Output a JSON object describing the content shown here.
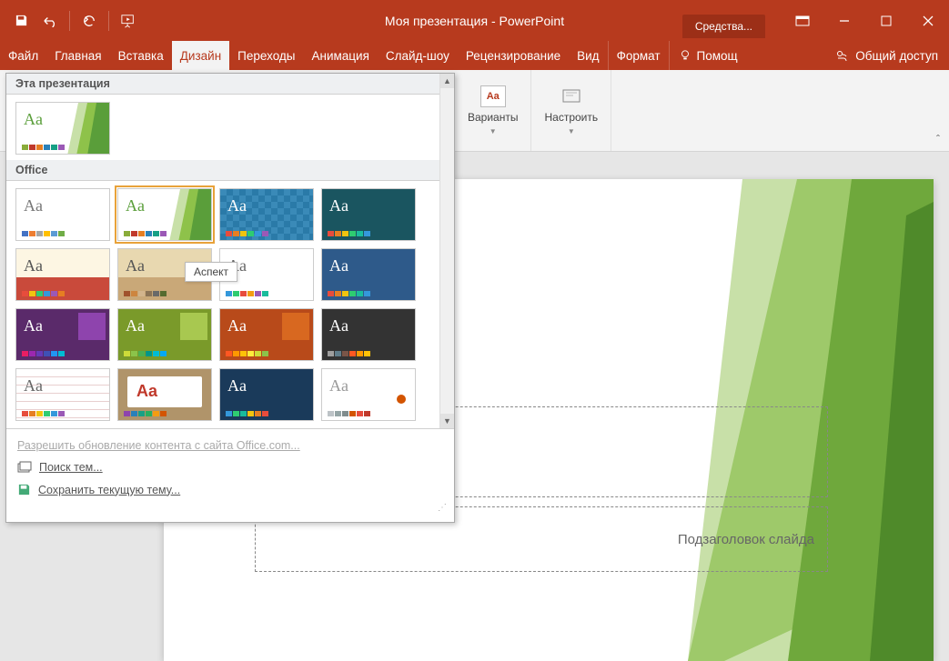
{
  "title": "Моя презентация - PowerPoint",
  "tools_tab": "Средства...",
  "tabs": {
    "file": "Файл",
    "home": "Главная",
    "insert": "Вставка",
    "design": "Дизайн",
    "transitions": "Переходы",
    "animation": "Анимация",
    "slideshow": "Слайд-шоу",
    "review": "Рецензирование",
    "view": "Вид",
    "format": "Формат",
    "help": "Помощ",
    "share": "Общий доступ"
  },
  "ribbon": {
    "variants": "Варианты",
    "customize": "Настроить",
    "variant_icon": "Aа"
  },
  "gallery": {
    "this_presentation": "Эта презентация",
    "office": "Office",
    "tooltip": "Аспект",
    "aa": "Aa",
    "enable_updates": "Разрешить обновление контента с сайта Office.com...",
    "search_themes": "Поиск тем...",
    "save_theme": "Сохранить текущую тему..."
  },
  "slide": {
    "subtitle_placeholder": "Подзаголовок слайда"
  },
  "themes": {
    "current": {
      "bg": "#ffffff",
      "aa_color": "#5a9e3a",
      "accent": "facet-green",
      "swatches": [
        "#8aac3a",
        "#c0392b",
        "#e67e22",
        "#2980b9",
        "#16a085",
        "#9b59b6"
      ]
    },
    "office": [
      {
        "bg": "#ffffff",
        "aa_color": "#777",
        "swatches": [
          "#4472c4",
          "#ed7d31",
          "#a5a5a5",
          "#ffc000",
          "#5b9bd5",
          "#70ad47"
        ]
      },
      {
        "bg": "#ffffff",
        "aa_color": "#5a9e3a",
        "accent": "facet-green",
        "swatches": [
          "#8aac3a",
          "#c0392b",
          "#e67e22",
          "#2980b9",
          "#16a085",
          "#9b59b6"
        ]
      },
      {
        "bg": "pattern-blue",
        "aa_color": "#fff",
        "swatches": [
          "#e74c3c",
          "#e67e22",
          "#f1c40f",
          "#2ecc71",
          "#3498db",
          "#9b59b6"
        ]
      },
      {
        "bg": "#1a5560",
        "aa_color": "#fff",
        "swatches": [
          "#e74c3c",
          "#e67e22",
          "#f1c40f",
          "#2ecc71",
          "#1abc9c",
          "#3498db"
        ]
      },
      {
        "bg": "split-cream",
        "aa_color": "#555",
        "swatches": [
          "#e74c3c",
          "#f1c40f",
          "#2ecc71",
          "#3498db",
          "#9b59b6",
          "#e67e22"
        ]
      },
      {
        "bg": "split-tan",
        "aa_color": "#555",
        "swatches": [
          "#a0522d",
          "#cd853f",
          "#d2b48c",
          "#8b7355",
          "#696969",
          "#556b2f"
        ]
      },
      {
        "bg": "#ffffff",
        "aa_color": "#666",
        "swatches": [
          "#3498db",
          "#2ecc71",
          "#e74c3c",
          "#f39c12",
          "#9b59b6",
          "#1abc9c"
        ]
      },
      {
        "bg": "#2e5a8a",
        "aa_color": "#fff",
        "swatches": [
          "#e74c3c",
          "#e67e22",
          "#f1c40f",
          "#2ecc71",
          "#1abc9c",
          "#3498db"
        ]
      },
      {
        "bg": "#5a2a6a",
        "aa_color": "#fff",
        "box": "#8e44ad",
        "swatches": [
          "#e91e63",
          "#9c27b0",
          "#673ab7",
          "#3f51b5",
          "#2196f3",
          "#00bcd4"
        ]
      },
      {
        "bg": "#7a9a2a",
        "aa_color": "#fff",
        "box": "#a8c850",
        "swatches": [
          "#cddc39",
          "#8bc34a",
          "#4caf50",
          "#009688",
          "#00bcd4",
          "#03a9f4"
        ]
      },
      {
        "bg": "#b84a1a",
        "aa_color": "#fff",
        "box": "#d86820",
        "swatches": [
          "#ff5722",
          "#ff9800",
          "#ffc107",
          "#ffeb3b",
          "#cddc39",
          "#8bc34a"
        ]
      },
      {
        "bg": "#333333",
        "aa_color": "#fff",
        "swatches": [
          "#9e9e9e",
          "#607d8b",
          "#795548",
          "#ff5722",
          "#ff9800",
          "#ffc107"
        ]
      },
      {
        "bg": "lined",
        "aa_color": "#666",
        "swatches": [
          "#e74c3c",
          "#e67e22",
          "#f1c40f",
          "#2ecc71",
          "#3498db",
          "#9b59b6"
        ]
      },
      {
        "bg": "billboard",
        "aa_color": "#c0392b",
        "swatches": [
          "#8e44ad",
          "#2980b9",
          "#16a085",
          "#27ae60",
          "#f39c12",
          "#d35400"
        ]
      },
      {
        "bg": "#1a3a5a",
        "aa_color": "#fff",
        "swatches": [
          "#3498db",
          "#2ecc71",
          "#1abc9c",
          "#f1c40f",
          "#e67e22",
          "#e74c3c"
        ]
      },
      {
        "bg": "#ffffff",
        "aa_color": "#999",
        "dot": true,
        "swatches": [
          "#bdc3c7",
          "#95a5a6",
          "#7f8c8d",
          "#d35400",
          "#e74c3c",
          "#c0392b"
        ]
      }
    ]
  }
}
